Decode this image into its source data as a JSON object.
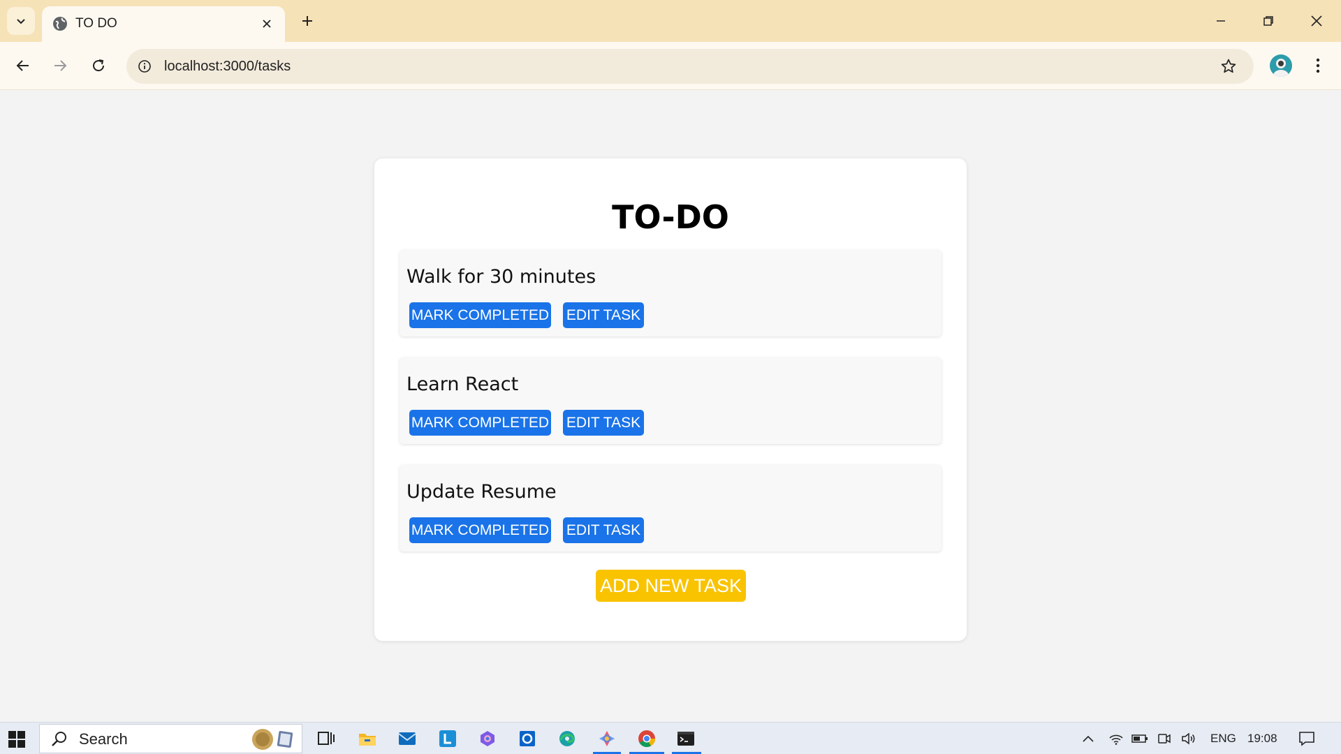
{
  "browser": {
    "tab_title": "TO DO",
    "url": "localhost:3000/tasks",
    "theme_color": "#f6e2b7"
  },
  "app": {
    "title": "TO-DO",
    "tasks": [
      {
        "title": "Walk for 30 minutes",
        "mark_label": "MARK COMPLETED",
        "edit_label": "EDIT TASK"
      },
      {
        "title": "Learn React",
        "mark_label": "MARK COMPLETED",
        "edit_label": "EDIT TASK"
      },
      {
        "title": "Update Resume",
        "mark_label": "MARK COMPLETED",
        "edit_label": "EDIT TASK"
      }
    ],
    "add_label": "ADD NEW TASK",
    "colors": {
      "primary_button": "#1a73e8",
      "add_button": "#f9c300"
    }
  },
  "taskbar": {
    "search_placeholder": "Search",
    "language": "ENG",
    "time": "19:08",
    "pinned_icons": [
      "task-view-icon",
      "file-explorer-icon",
      "mail-icon",
      "l-app-icon",
      "copilot-icon",
      "outlook-icon",
      "edge-icon",
      "gemini-icon",
      "chrome-icon",
      "terminal-icon"
    ]
  }
}
